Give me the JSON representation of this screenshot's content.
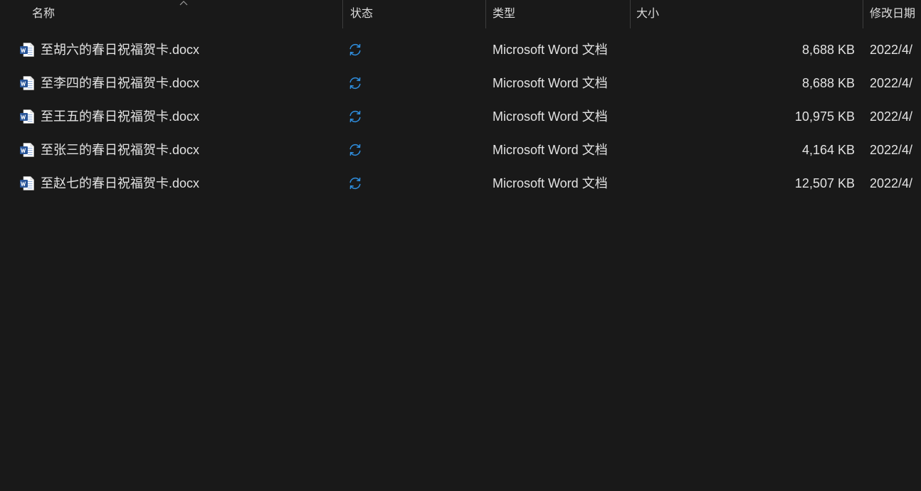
{
  "columns": {
    "name": "名称",
    "status": "状态",
    "type": "类型",
    "size": "大小",
    "modified": "修改日期"
  },
  "files": [
    {
      "name": "至胡六的春日祝福贺卡.docx",
      "status_icon": "sync-icon",
      "type": "Microsoft Word 文档",
      "size": "8,688 KB",
      "modified": "2022/4/"
    },
    {
      "name": "至李四的春日祝福贺卡.docx",
      "status_icon": "sync-icon",
      "type": "Microsoft Word 文档",
      "size": "8,688 KB",
      "modified": "2022/4/"
    },
    {
      "name": "至王五的春日祝福贺卡.docx",
      "status_icon": "sync-icon",
      "type": "Microsoft Word 文档",
      "size": "10,975 KB",
      "modified": "2022/4/"
    },
    {
      "name": "至张三的春日祝福贺卡.docx",
      "status_icon": "sync-icon",
      "type": "Microsoft Word 文档",
      "size": "4,164 KB",
      "modified": "2022/4/"
    },
    {
      "name": "至赵七的春日祝福贺卡.docx",
      "status_icon": "sync-icon",
      "type": "Microsoft Word 文档",
      "size": "12,507 KB",
      "modified": "2022/4/"
    }
  ],
  "colors": {
    "background": "#191919",
    "text": "#e2e2e2",
    "sync_blue": "#2f8fe0",
    "word_blue": "#2b579a"
  }
}
